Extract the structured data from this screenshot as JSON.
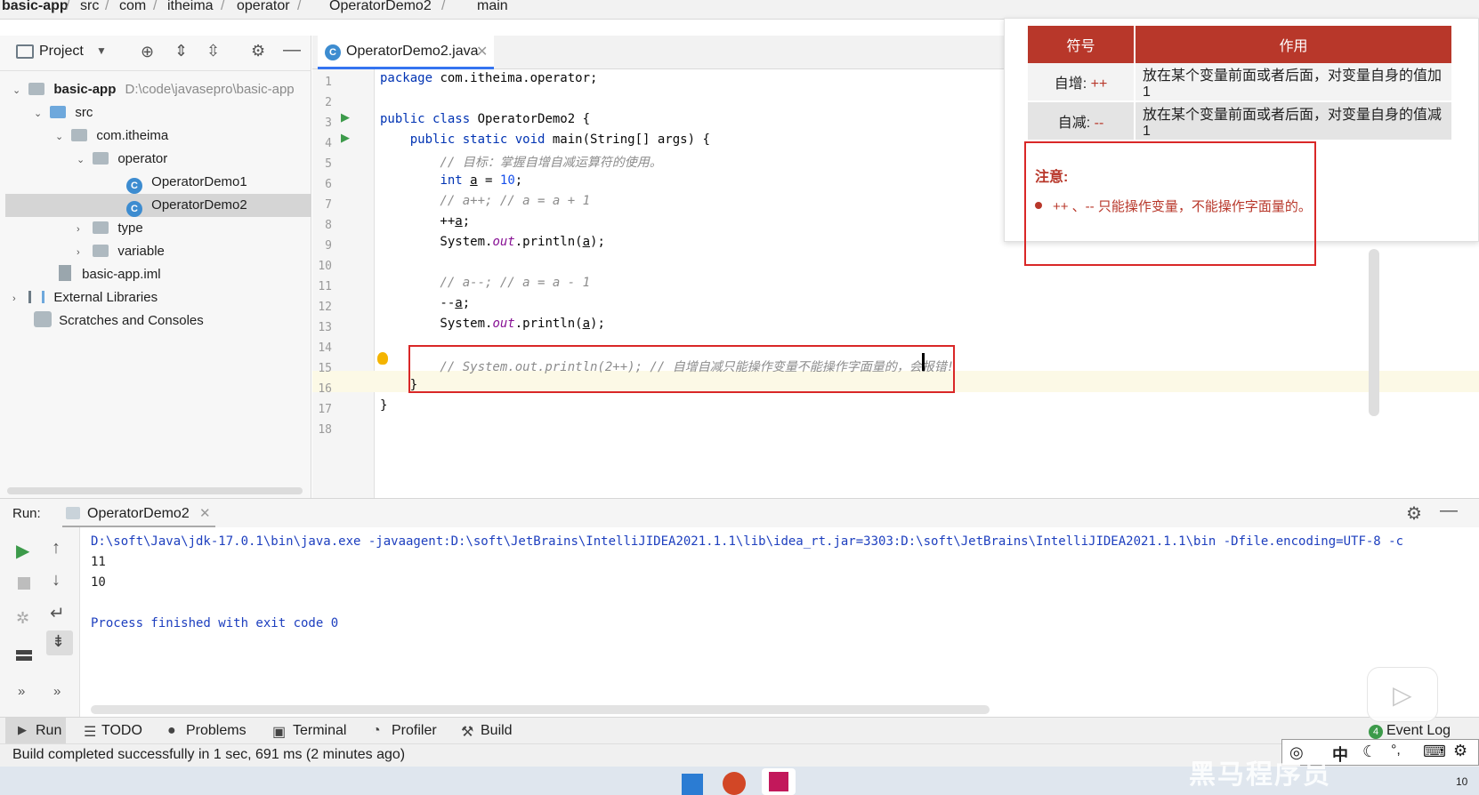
{
  "breadcrumb": [
    "basic-app",
    "src",
    "com",
    "itheima",
    "operator",
    "OperatorDemo2",
    "main"
  ],
  "project_panel": {
    "title": "Project",
    "tree": [
      {
        "label": "basic-app",
        "hint": "D:\\code\\javasepro\\basic-app"
      },
      {
        "label": "src"
      },
      {
        "label": "com.itheima"
      },
      {
        "label": "operator"
      },
      {
        "label": "OperatorDemo1"
      },
      {
        "label": "OperatorDemo2"
      },
      {
        "label": "type"
      },
      {
        "label": "variable"
      },
      {
        "label": "basic-app.iml"
      },
      {
        "label": "External Libraries"
      },
      {
        "label": "Scratches and Consoles"
      }
    ]
  },
  "editor": {
    "tab_label": "OperatorDemo2.java",
    "line_numbers": [
      "1",
      "2",
      "3",
      "4",
      "5",
      "6",
      "7",
      "8",
      "9",
      "10",
      "11",
      "12",
      "13",
      "14",
      "15",
      "16",
      "17",
      "18"
    ],
    "current_line": "15"
  },
  "run_panel": {
    "label": "Run:",
    "tab_label": "OperatorDemo2",
    "command": "D:\\soft\\Java\\jdk-17.0.1\\bin\\java.exe -javaagent:D:\\soft\\JetBrains\\IntelliJIDEA2021.1.1\\lib\\idea_rt.jar=3303:D:\\soft\\JetBrains\\IntelliJIDEA2021.1.1\\bin -Dfile.encoding=UTF-8 -c",
    "output": [
      "11",
      "10"
    ],
    "exit_message": "Process finished with exit code 0"
  },
  "bottom_tools": {
    "tabs": [
      "Run",
      "TODO",
      "Problems",
      "Terminal",
      "Profiler",
      "Build"
    ],
    "event_log_count": "4",
    "event_log": "Event Log"
  },
  "status_bar": {
    "message": "Build completed successfully in 1 sec, 691 ms (2 minutes ago)"
  },
  "ime": {
    "lang": "中"
  },
  "taskbar": {
    "time_fragment": "10"
  },
  "slide": {
    "headers": [
      "符号",
      "作用"
    ],
    "rows": [
      {
        "symbol_name": "自增:",
        "symbol": "++",
        "desc": "放在某个变量前面或者后面，对变量自身的值加1"
      },
      {
        "symbol_name": "自减:",
        "symbol": "--",
        "desc": "放在某个变量前面或者后面，对变量自身的值减1"
      }
    ],
    "note_title": "注意:",
    "note_text": "++ 、-- 只能操作变量，不能操作字面量的。"
  },
  "watermark": "黑马程序员",
  "colors": {
    "accent_red": "#b8372a",
    "highlight_red": "#d92727",
    "run_green": "#3c9a4a",
    "keyword_blue": "#0033b3"
  }
}
